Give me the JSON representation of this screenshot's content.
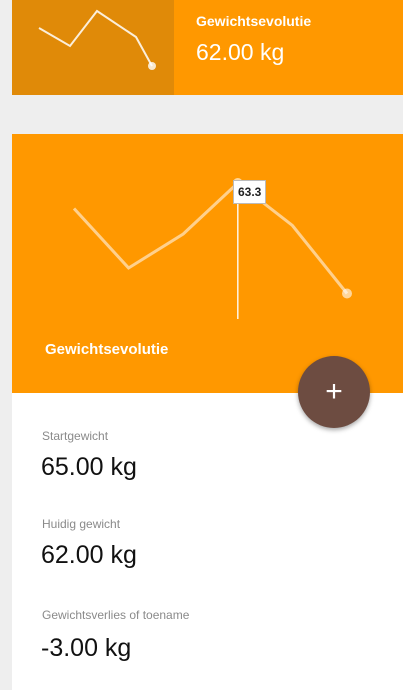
{
  "summary": {
    "title": "Gewichtsevolutie",
    "value": "62.00 kg"
  },
  "chart": {
    "title": "Gewichtsevolutie",
    "tooltip_value": "63.3",
    "accent_color": "#ff9800",
    "fab_color": "#6d4c41",
    "add_icon": "plus-icon"
  },
  "chart_data": {
    "type": "line",
    "values": [
      63.0,
      62.3,
      62.7,
      63.3,
      62.8,
      62.0
    ],
    "highlight_index": 3,
    "highlight_value": 63.3
  },
  "stats": [
    {
      "label": "Startgewicht",
      "value": "65.00 kg"
    },
    {
      "label": "Huidig gewicht",
      "value": "62.00 kg"
    },
    {
      "label": "Gewichtsverlies of toename",
      "value": "-3.00 kg"
    }
  ],
  "fab": {
    "label": "+"
  }
}
